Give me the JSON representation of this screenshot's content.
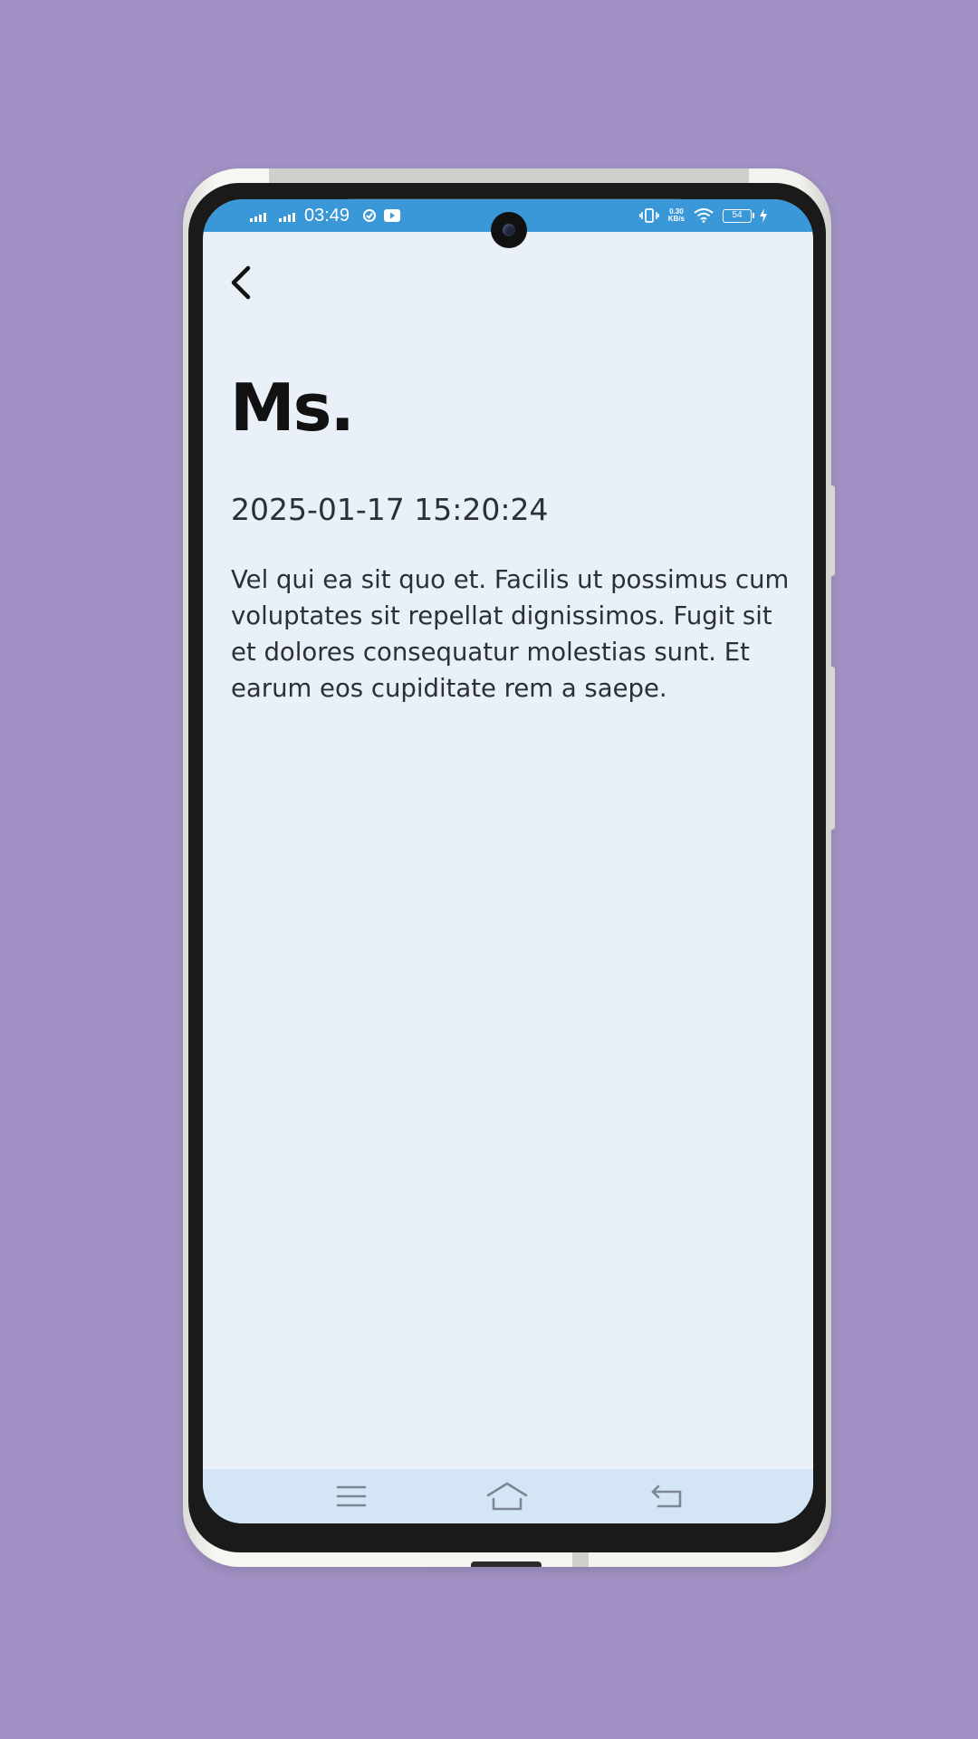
{
  "status_bar": {
    "time": "03:49",
    "network_speed_value": "0.30",
    "network_speed_unit": "KB/s",
    "battery_level": "54"
  },
  "header": {
    "back_icon": "chevron-left-icon"
  },
  "detail": {
    "title": "Ms.",
    "timestamp": "2025-01-17 15:20:24",
    "body": "Vel qui ea sit quo et. Facilis ut possimus cum voluptates sit repellat dignissimos. Fugit sit et dolores consequatur molestias sunt. Et earum eos cupiditate rem a saepe."
  },
  "nav_bar": {
    "icons": [
      "menu-icon",
      "home-icon",
      "back-icon"
    ]
  },
  "colors": {
    "background": "#a191c4",
    "status_bar": "#3a98d9",
    "screen": "#e9f0f7",
    "nav_bar": "#d4e5f5"
  }
}
